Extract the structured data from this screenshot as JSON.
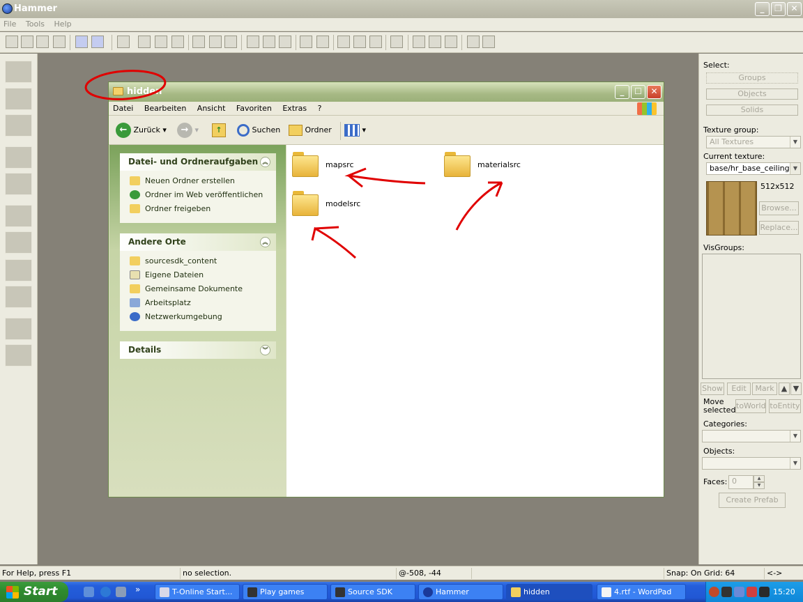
{
  "hammer": {
    "title": "Hammer",
    "menu": [
      "File",
      "Tools",
      "Help"
    ],
    "window_buttons": {
      "minimize": "_",
      "restore": "❐",
      "close": "✕"
    }
  },
  "right_panel": {
    "select_label": "Select:",
    "select_buttons": [
      "Groups",
      "Objects",
      "Solids"
    ],
    "texture_group_label": "Texture group:",
    "texture_group_value": "All Textures",
    "current_texture_label": "Current texture:",
    "current_texture_value": "base/hr_base_ceilingtile",
    "texture_size": "512x512",
    "browse_label": "Browse...",
    "replace_label": "Replace...",
    "visgroups_label": "VisGroups:",
    "vis_buttons": [
      "Show",
      "Edit",
      "Mark"
    ],
    "move_selected_label": "Move selected:",
    "to_world_label": "toWorld",
    "to_entity_label": "toEntity",
    "categories_label": "Categories:",
    "objects_label": "Objects:",
    "faces_label": "Faces:",
    "faces_value": "0",
    "create_prefab_label": "Create Prefab"
  },
  "status": {
    "help": "For Help, press F1",
    "selection": "no selection.",
    "coords": "@-508, -44",
    "snap": "Snap: On Grid: 64",
    "arrows": "<->"
  },
  "explorer": {
    "title": "hidden",
    "menu": [
      "Datei",
      "Bearbeiten",
      "Ansicht",
      "Favoriten",
      "Extras",
      "?"
    ],
    "toolbar": {
      "back": "Zurück",
      "search": "Suchen",
      "folders": "Ordner"
    },
    "tasks_pane": {
      "title": "Datei- und Ordneraufgaben",
      "items": [
        "Neuen Ordner erstellen",
        "Ordner im Web veröffentlichen",
        "Ordner freigeben"
      ]
    },
    "places_pane": {
      "title": "Andere Orte",
      "items": [
        "sourcesdk_content",
        "Eigene Dateien",
        "Gemeinsame Dokumente",
        "Arbeitsplatz",
        "Netzwerkumgebung"
      ]
    },
    "details_pane": {
      "title": "Details"
    },
    "folders": [
      "mapsrc",
      "materialsrc",
      "modelsrc"
    ]
  },
  "taskbar": {
    "start_label": "Start",
    "quicklaunch_more": "»",
    "tasks": [
      "T-Online Start...",
      "Play games",
      "Source SDK",
      "Hammer",
      "hidden",
      "4.rtf - WordPad"
    ],
    "clock": "15:20"
  },
  "colors": {
    "annotation": "#e00000",
    "xp_blue": "#245edb",
    "olive": "#a7b985"
  }
}
